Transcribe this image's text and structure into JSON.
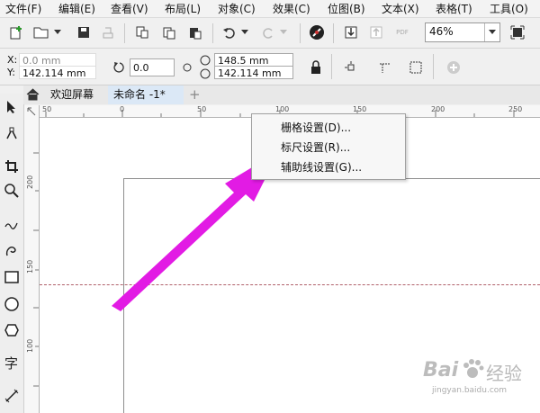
{
  "menubar": {
    "items": [
      "文件(F)",
      "编辑(E)",
      "查看(V)",
      "布局(L)",
      "对象(C)",
      "效果(C)",
      "位图(B)",
      "文本(X)",
      "表格(T)",
      "工具(O)"
    ]
  },
  "toolbar": {
    "pdf_label": "PDF",
    "zoom_value": "46%"
  },
  "property_bar": {
    "x_label": "X:",
    "x_value": "0.0 mm",
    "y_label": "Y:",
    "y_value": "142.114 mm",
    "rotation_value": "0.0",
    "width_value": "148.5 mm",
    "height_value": "142.114 mm"
  },
  "tabs": {
    "welcome": "欢迎屏幕",
    "document": "未命名 -1*",
    "add": "+"
  },
  "hruler": {
    "labels": [
      "50",
      "0",
      "50",
      "100",
      "150",
      "200",
      "250"
    ]
  },
  "vruler": {
    "labels": [
      "200",
      "150",
      "100"
    ]
  },
  "context_menu": {
    "items": [
      "栅格设置(D)...",
      "标尺设置(R)...",
      "辅助线设置(G)..."
    ]
  },
  "watermark": {
    "brand": "Bai",
    "brand2": "经验",
    "url": "jingyan.baidu.com"
  },
  "colors": {
    "arrow": "#e21be4",
    "guide": "#b0606a",
    "active_tab": "#dbe8f6"
  }
}
